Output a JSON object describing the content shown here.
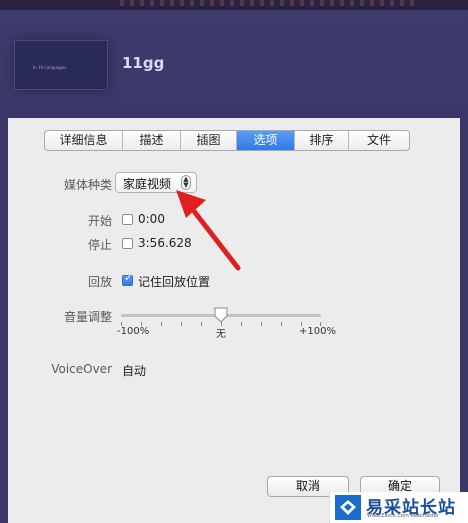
{
  "header": {
    "title": "11gg",
    "thumbnail_caption": "In 19 Languages"
  },
  "tabs": [
    {
      "label": "详细信息"
    },
    {
      "label": "描述"
    },
    {
      "label": "插图"
    },
    {
      "label": "选项"
    },
    {
      "label": "排序"
    },
    {
      "label": "文件"
    }
  ],
  "active_tab": "选项",
  "media_kind": {
    "label": "媒体种类",
    "value": "家庭视频"
  },
  "start": {
    "label": "开始",
    "value": "0:00",
    "checked": false
  },
  "stop": {
    "label": "停止",
    "value": "3:56.628",
    "checked": false
  },
  "playback": {
    "label": "回放",
    "option": "记住回放位置",
    "checked": true
  },
  "volume": {
    "label": "音量调整",
    "min": "-100%",
    "mid": "无",
    "max": "+100%",
    "level_percent": 50
  },
  "voiceover": {
    "label": "VoiceOver",
    "value": "自动"
  },
  "buttons": {
    "cancel": "取消",
    "ok": "确定"
  },
  "watermark": {
    "text": "易采站长站",
    "subtext": "Www.Easck.Com Webmaster"
  },
  "colors": {
    "accent": "#2f78e8",
    "annotation_arrow": "#e02020",
    "background": "#3b3868",
    "sheet": "#ececec"
  }
}
